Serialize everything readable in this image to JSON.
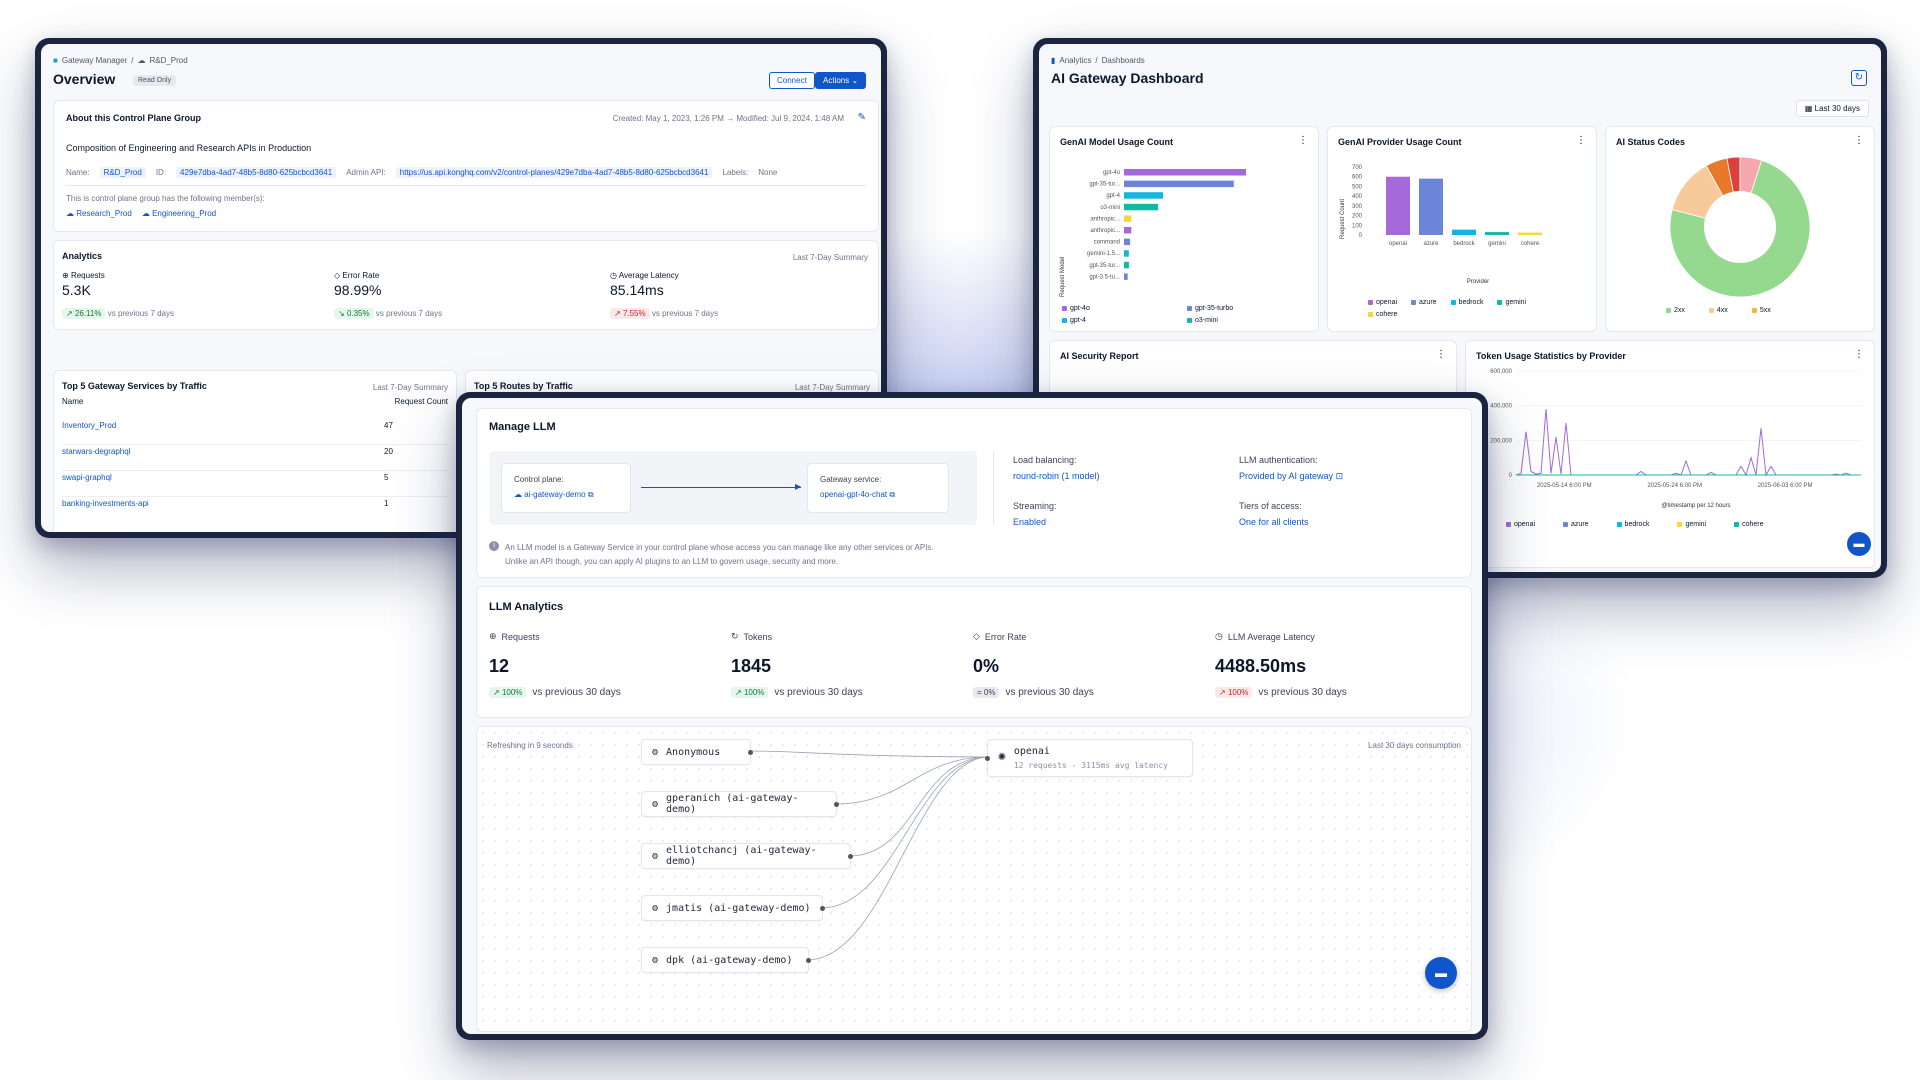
{
  "overview": {
    "breadcrumb": [
      "Gateway Manager",
      "R&D_Prod"
    ],
    "title": "Overview",
    "badge": "Read Only",
    "connect_label": "Connect",
    "actions_label": "Actions",
    "about": {
      "heading": "About this Control Plane Group",
      "created": "Created: May 1, 2023, 1:26 PM",
      "modified": "Modified: Jul 9, 2024, 1:48 AM",
      "description": "Composition of Engineering and Research APIs in Production",
      "name_label": "Name:",
      "name_value": "R&D_Prod",
      "id_label": "ID:",
      "id_value": "429e7dba-4ad7-48b5-8d80-625bcbcd3641",
      "admin_label": "Admin API:",
      "admin_value": "https://us.api.konghq.com/v2/control-planes/429e7dba-4ad7-48b5-8d80-625bcbcd3641",
      "labels_label": "Labels:",
      "labels_value": "None",
      "members_text": "This is control plane group has the following member(s):",
      "members": [
        "Research_Prod",
        "Engineering_Prod"
      ]
    },
    "analytics": {
      "heading": "Analytics",
      "summary": "Last 7-Day Summary",
      "metrics": [
        {
          "label": "Requests",
          "value": "5.3K",
          "change": "26.11%",
          "cmp": "vs previous 7 days",
          "trend": "up"
        },
        {
          "label": "Error Rate",
          "value": "98.99%",
          "change": "0.35%",
          "cmp": "vs previous 7 days",
          "trend": "down-good"
        },
        {
          "label": "Average Latency",
          "value": "85.14ms",
          "change": "7.55%",
          "cmp": "vs previous 7 days",
          "trend": "up-bad"
        }
      ]
    },
    "top_services": {
      "heading": "Top 5 Gateway Services by Traffic",
      "summary": "Last 7-Day Summary",
      "col_name": "Name",
      "col_count": "Request Count",
      "rows": [
        {
          "name": "Inventory_Prod",
          "count": "47"
        },
        {
          "name": "starwars-degraphql",
          "count": "20"
        },
        {
          "name": "swapi-graphql",
          "count": "5"
        },
        {
          "name": "banking-investments-api",
          "count": "1"
        }
      ]
    },
    "top_routes": {
      "heading": "Top 5 Routes by Traffic",
      "summary": "Last 7-Day Summary"
    }
  },
  "dashboard": {
    "breadcrumb": [
      "Analytics",
      "Dashboards"
    ],
    "title": "AI Gateway Dashboard",
    "range": "Last 30 days",
    "model_usage": {
      "heading": "GenAI Model Usage Count",
      "ylabel": "Request Model",
      "labels": [
        "gpt-4o",
        "gpt-35-tur...",
        "gpt-4",
        "o3-mini",
        "anthropic...",
        "anthropic...",
        "command",
        "gemini-1.5...",
        "gpt-35-tur...",
        "gpt-3.5-tu..."
      ],
      "legend": [
        "gpt-4o",
        "gpt-35-turbo",
        "gpt-4",
        "o3-mini"
      ]
    },
    "provider_usage": {
      "heading": "GenAI Provider Usage Count",
      "ylabel": "Request Count",
      "xlabel": "Provider",
      "ticks": [
        "700",
        "600",
        "500",
        "400",
        "300",
        "200",
        "100",
        "0"
      ],
      "legend": [
        "openai",
        "azure",
        "bedrock",
        "gemini",
        "cohere"
      ]
    },
    "status_codes": {
      "heading": "AI Status Codes",
      "legend": [
        "2xx",
        "4xx",
        "5xx"
      ]
    },
    "security": {
      "heading": "AI Security Report"
    },
    "token_usage": {
      "heading": "Token Usage Statistics by Provider",
      "ticks": [
        "600,000",
        "400,000",
        "200,000",
        "0"
      ],
      "xticks": [
        "2025-05-14 6:00 PM",
        "2025-05-24 6:00 PM",
        "2025-06-03 6:00 PM"
      ],
      "xlabel": "@timestamp per 12 hours",
      "legend": [
        "openai",
        "azure",
        "bedrock",
        "gemini",
        "cohere"
      ]
    }
  },
  "chart_data": [
    {
      "type": "bar",
      "title": "GenAI Model Usage Count",
      "orientation": "horizontal",
      "categories": [
        "gpt-4o",
        "gpt-35-tur...",
        "gpt-4",
        "o3-mini",
        "anthropic...",
        "anthropic...",
        "command",
        "gemini-1.5...",
        "gpt-35-tur...",
        "gpt-3.5-tu..."
      ],
      "values": [
        100,
        90,
        32,
        28,
        6,
        6,
        5,
        4,
        4,
        3
      ],
      "ylabel": "Request Model"
    },
    {
      "type": "bar",
      "title": "GenAI Provider Usage Count",
      "categories": [
        "openai",
        "azure",
        "bedrock",
        "gemini",
        "cohere"
      ],
      "values": [
        600,
        580,
        55,
        30,
        25
      ],
      "ylim": [
        0,
        700
      ],
      "ylabel": "Request Count",
      "xlabel": "Provider"
    },
    {
      "type": "pie",
      "title": "AI Status Codes",
      "labels": [
        "2xx",
        "4xx",
        "4xx-b",
        "5xx",
        "5xx-b"
      ],
      "values": [
        74,
        13,
        5,
        3,
        5
      ]
    },
    {
      "type": "line",
      "title": "Token Usage Statistics by Provider",
      "xlabel": "@timestamp per 12 hours",
      "ylim": [
        0,
        600000
      ],
      "series": [
        {
          "name": "openai",
          "values": [
            0,
            10000,
            250000,
            20000,
            5000,
            10000,
            380000,
            10000,
            220000,
            5000,
            300000,
            0,
            0,
            0,
            0,
            0,
            0,
            0,
            0,
            0,
            0,
            0,
            0,
            0,
            0,
            20000,
            0,
            0,
            0,
            0,
            0,
            0,
            10000,
            0,
            80000,
            0,
            0,
            0,
            0,
            15000,
            0,
            0,
            0,
            0,
            0,
            50000,
            0,
            100000,
            0,
            270000,
            0,
            50000,
            0,
            0,
            0,
            0,
            0,
            0,
            0,
            0,
            0,
            0,
            0,
            0,
            5000,
            0,
            10000,
            0,
            0,
            0
          ]
        },
        {
          "name": "azure",
          "values": [
            0,
            0,
            0,
            0,
            0,
            0,
            0,
            0,
            0,
            0,
            0,
            0,
            0,
            0,
            0,
            0,
            0,
            0,
            0,
            0,
            0,
            0,
            0,
            0,
            0,
            0,
            0,
            0,
            0,
            0,
            0,
            0,
            0,
            0,
            0,
            0,
            0,
            0,
            0,
            0,
            0,
            0,
            0,
            0,
            0,
            0,
            0,
            0,
            0,
            0,
            0,
            0,
            0,
            0,
            0,
            0,
            0,
            0,
            0,
            0,
            0,
            0,
            0,
            0,
            0,
            0,
            0,
            0,
            0,
            0
          ]
        }
      ]
    }
  ],
  "llm": {
    "manage_heading": "Manage LLM",
    "control_plane_label": "Control plane:",
    "control_plane_value": "ai-gateway-demo",
    "gateway_service_label": "Gateway service:",
    "gateway_service_value": "openai-gpt-4o-chat",
    "load_balancing_label": "Load balancing:",
    "load_balancing_value": "round-robin (1 model)",
    "auth_label": "LLM authentication:",
    "auth_value": "Provided by AI gateway",
    "streaming_label": "Streaming:",
    "streaming_value": "Enabled",
    "tiers_label": "Tiers of access:",
    "tiers_value": "One for all clients",
    "info_line1": "An LLM model is a Gateway Service in your control plane whose access you can manage like any other services or APIs.",
    "info_line2": "Unlike an API though, you can apply AI plugins to an LLM to govern usage, security and more.",
    "analytics_heading": "LLM Analytics",
    "metrics": [
      {
        "label": "Requests",
        "value": "12",
        "change": "100%",
        "cmp": "vs previous 30 days",
        "trend": "up"
      },
      {
        "label": "Tokens",
        "value": "1845",
        "change": "100%",
        "cmp": "vs previous 30 days",
        "trend": "up"
      },
      {
        "label": "Error Rate",
        "value": "0%",
        "change": "0%",
        "cmp": "vs previous 30 days",
        "trend": "flat"
      },
      {
        "label": "LLM Average Latency",
        "value": "4488.50ms",
        "change": "100%",
        "cmp": "vs previous 30 days",
        "trend": "up-bad"
      }
    ],
    "refresh_text": "Refreshing in 9 seconds",
    "consumption_text": "Last 30 days consumption",
    "consumers": [
      "Anonymous",
      "gperanich (ai-gateway-demo)",
      "elliotchancj (ai-gateway-demo)",
      "jmatis (ai-gateway-demo)",
      "dpk (ai-gateway-demo)"
    ],
    "target_name": "openai",
    "target_stats": "12 requests - 3115ms avg latency"
  },
  "colors": {
    "purple": "#a569d9",
    "blue": "#6b86d6",
    "cyan": "#15b5e0",
    "teal": "#12b8a3",
    "yellow": "#f5d838",
    "green2xx": "#95d98f",
    "peach4xx": "#f8c99a",
    "orange": "#e8792a",
    "pink5xx": "#f7a8ad",
    "red": "#d9423c",
    "accent": "#1155cb"
  }
}
